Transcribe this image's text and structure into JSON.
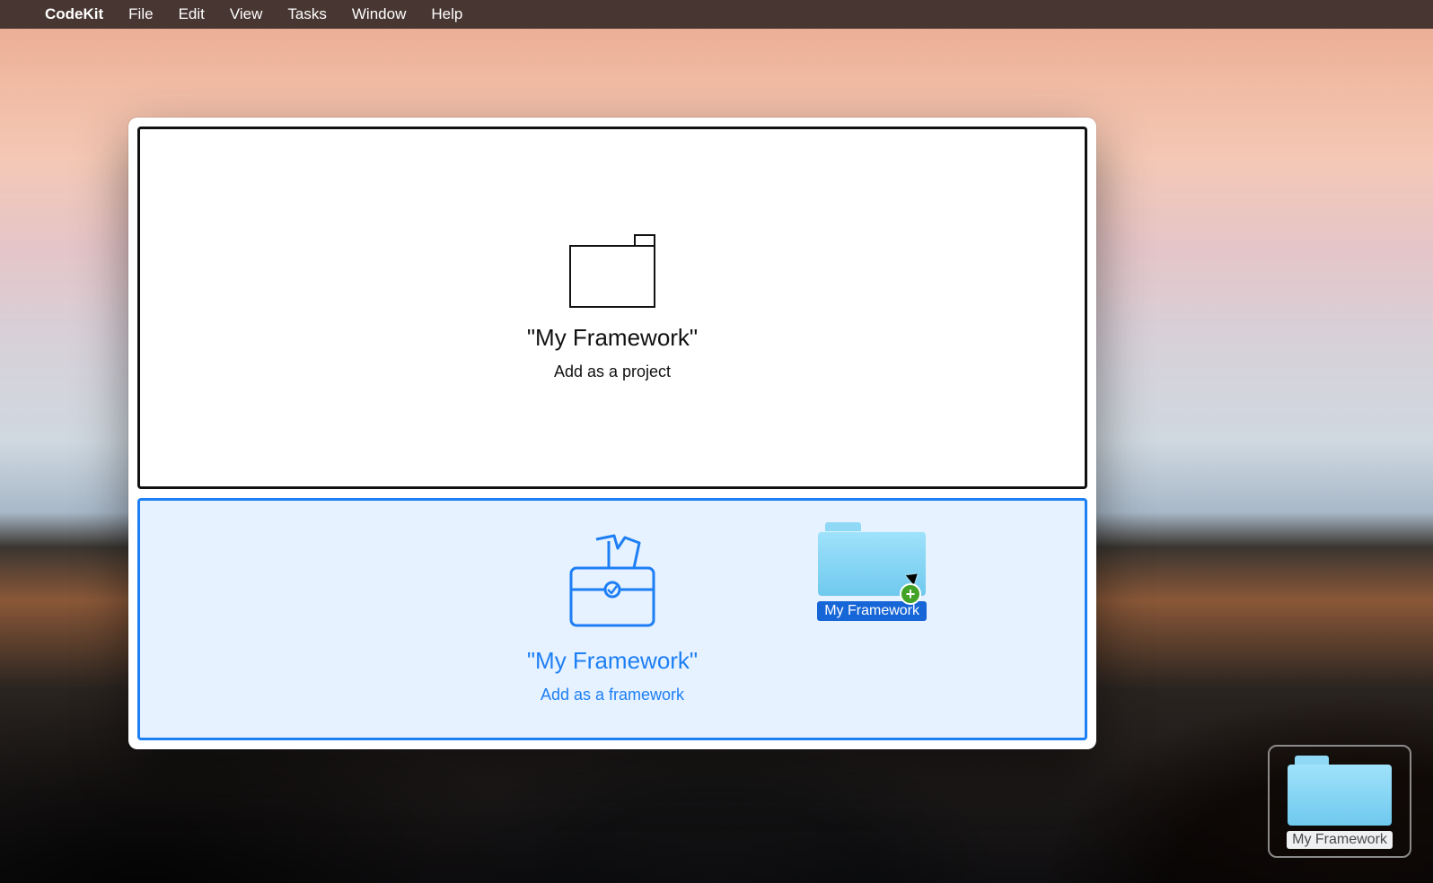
{
  "menubar": {
    "app_name": "CodeKit",
    "items": [
      "File",
      "Edit",
      "View",
      "Tasks",
      "Window",
      "Help"
    ]
  },
  "window": {
    "project_zone": {
      "title": "\"My Framework\"",
      "subtitle": "Add as a project"
    },
    "framework_zone": {
      "title": "\"My Framework\"",
      "subtitle": "Add as a framework",
      "dragged_item_label": "My Framework"
    }
  },
  "desktop": {
    "folder_label": "My Framework"
  },
  "icons": {
    "apple": "apple-logo",
    "folder_outline": "folder-outline-icon",
    "briefcase": "framework-briefcase-icon",
    "mac_folder": "mac-folder-icon",
    "plus_badge": "add-plus-badge-icon",
    "cursor": "pointer-cursor-icon"
  },
  "colors": {
    "accent_blue": "#1e7ff5",
    "framework_bg": "#e6f2ff",
    "plus_green": "#43a329",
    "selection_blue": "#1766d7"
  }
}
